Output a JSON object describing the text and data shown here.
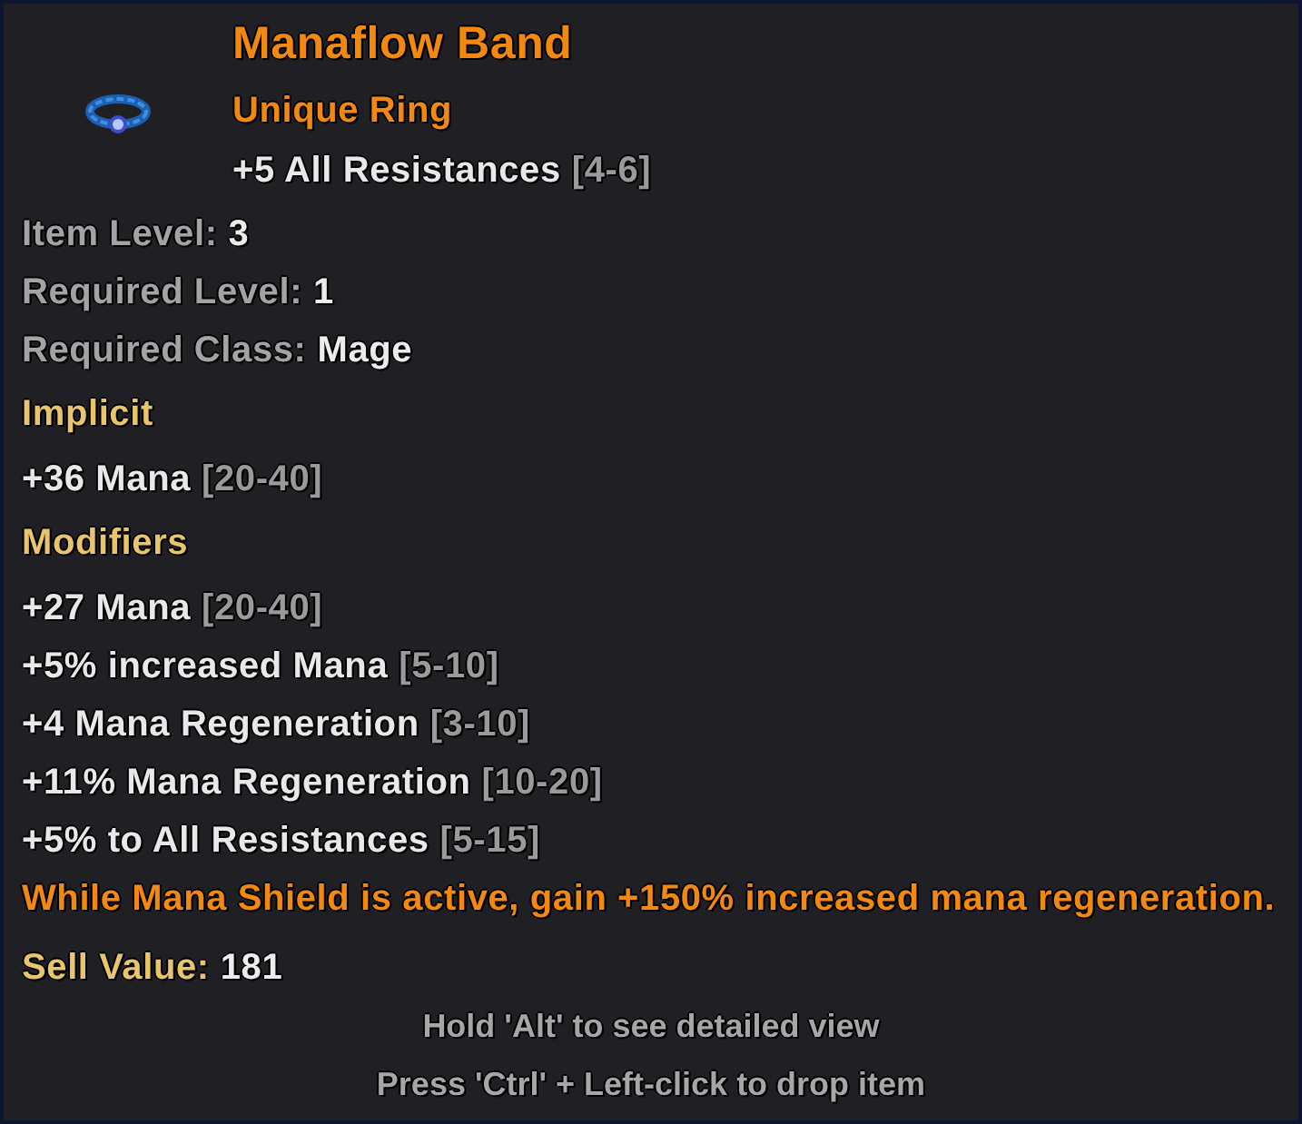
{
  "item": {
    "name": "Manaflow Band",
    "type": "Unique Ring",
    "header_stats": [
      {
        "kind": "rolled",
        "text": "+5 All Resistances",
        "range": "[4-6]"
      }
    ]
  },
  "properties": [
    {
      "label": "Item Level:",
      "value": "3"
    },
    {
      "label": "Required Level:",
      "value": "1"
    },
    {
      "label": "Required Class:",
      "value": "Mage"
    }
  ],
  "sections": [
    {
      "heading": "Implicit",
      "modifiers": [
        {
          "kind": "rolled",
          "text": "+36 Mana",
          "range": "[20-40]"
        }
      ]
    },
    {
      "heading": "Modifiers",
      "modifiers": [
        {
          "kind": "rolled",
          "text": "+27 Mana",
          "range": "[20-40]"
        },
        {
          "kind": "rolled",
          "text": "+5% increased Mana",
          "range": "[5-10]"
        },
        {
          "kind": "rolled",
          "text": "+4 Mana Regeneration",
          "range": "[3-10]"
        },
        {
          "kind": "rolled",
          "text": "+11% Mana Regeneration",
          "range": "[10-20]"
        },
        {
          "kind": "rolled",
          "text": "+5% to All Resistances",
          "range": "[5-15]"
        },
        {
          "kind": "unique",
          "text": "While Mana Shield is active, gain +150% increased mana regeneration."
        }
      ]
    }
  ],
  "sell_value": {
    "label": "Sell Value:",
    "value": "181"
  },
  "hints": [
    "Hold 'Alt' to see detailed view",
    "Press 'Ctrl' + Left-click to drop item"
  ]
}
